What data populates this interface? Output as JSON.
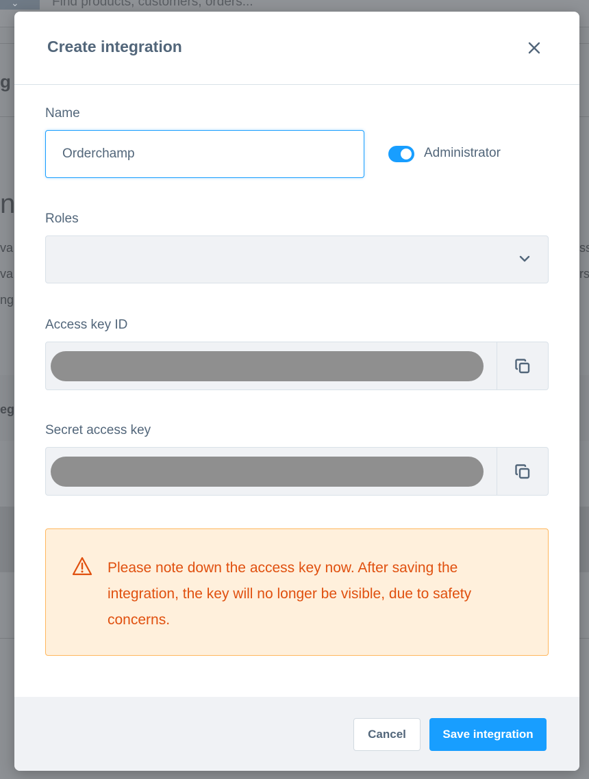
{
  "background": {
    "search_placeholder": "Find products, customers, orders...",
    "fragments": {
      "left_1": "g",
      "left_2": "n",
      "left_3": "va",
      "left_4": "va",
      "left_5": "ng",
      "left_6": "eg",
      "right_1": "ss",
      "right_2": "rst"
    }
  },
  "modal": {
    "title": "Create integration",
    "close_icon": "close-icon",
    "name": {
      "label": "Name",
      "value": "Orderchamp"
    },
    "administrator": {
      "label": "Administrator",
      "enabled": true
    },
    "roles": {
      "label": "Roles",
      "selected": ""
    },
    "access_key_id": {
      "label": "Access key ID",
      "copy_icon": "copy-icon"
    },
    "secret_access_key": {
      "label": "Secret access key",
      "copy_icon": "copy-icon"
    },
    "alert": {
      "icon": "warning-triangle-icon",
      "text": "Please note down the access key now. After saving the integration, the key will no longer be visible, due to safety concerns."
    },
    "footer": {
      "cancel_label": "Cancel",
      "save_label": "Save integration"
    }
  },
  "colors": {
    "accent": "#189eff",
    "warning_text": "#e0500f",
    "warning_bg": "#fff0dc",
    "warning_border": "#ffb75d"
  }
}
